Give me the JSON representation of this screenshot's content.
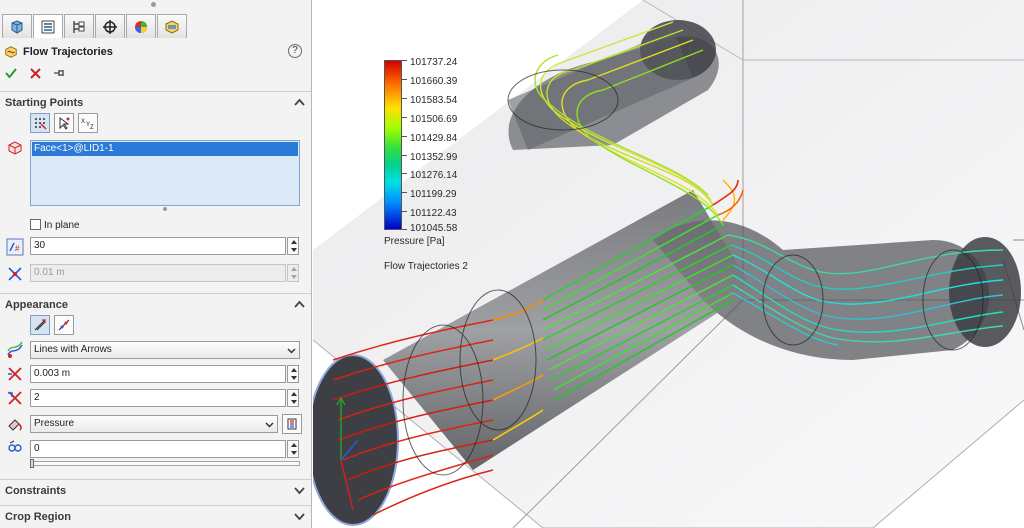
{
  "panel": {
    "tabs": [
      "feature-manager",
      "property-manager",
      "configuration-manager",
      "dim-xpert-manager",
      "display-manager",
      "flow-simulation-analysis"
    ],
    "title": "Flow Trajectories",
    "help": "?",
    "sections": {
      "starting_points": {
        "label": "Starting Points",
        "selected_face": "Face<1>@LID1-1",
        "in_plane_label": "In plane",
        "in_plane_checked": false,
        "number_of_points": "30",
        "spacing_placeholder": "0.01 m"
      },
      "appearance": {
        "label": "Appearance",
        "draw_style": "Lines with Arrows",
        "width": "0.003 m",
        "arrow_size": "2",
        "color_by": "Pressure",
        "extra_value": "0",
        "slider_fraction": 0.0
      },
      "constraints": {
        "label": "Constraints",
        "collapsed": true
      },
      "crop_region": {
        "label": "Crop Region",
        "collapsed": true
      }
    }
  },
  "legend": {
    "values": [
      "101737.24",
      "101660.39",
      "101583.54",
      "101506.69",
      "101429.84",
      "101352.99",
      "101276.14",
      "101199.29",
      "101122.43",
      "101045.58"
    ],
    "unit": "Pressure [Pa]",
    "plot_name": "Flow Trajectories 2",
    "colors": [
      "#d40000",
      "#ff7000",
      "#ffe000",
      "#a0ff00",
      "#30e040",
      "#00d090",
      "#00e0e0",
      "#0090ff",
      "#0000c8"
    ]
  },
  "colors": {
    "accent_selection": "#2b7ad8",
    "check_ok": "#2a9a2a",
    "close_x": "#d02020",
    "panel_bg": "#f3f3f3"
  }
}
